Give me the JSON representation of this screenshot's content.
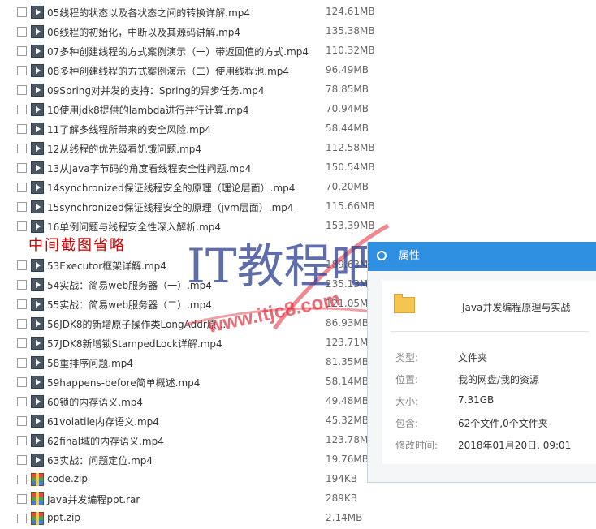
{
  "files": [
    {
      "name": "05线程的状态以及各状态之间的转换详解.mp4",
      "size": "124.61MB",
      "type": "video"
    },
    {
      "name": "06线程的初始化，中断以及其源码讲解.mp4",
      "size": "135.38MB",
      "type": "video"
    },
    {
      "name": "07多种创建线程的方式案例演示（一）带返回值的方式.mp4",
      "size": "110.32MB",
      "type": "video"
    },
    {
      "name": "08多种创建线程的方式案例演示（二）使用线程池.mp4",
      "size": "96.49MB",
      "type": "video"
    },
    {
      "name": "09Spring对并发的支持：Spring的异步任务.mp4",
      "size": "78.85MB",
      "type": "video"
    },
    {
      "name": "10使用jdk8提供的lambda进行并行计算.mp4",
      "size": "70.94MB",
      "type": "video"
    },
    {
      "name": "11了解多线程所带来的安全风险.mp4",
      "size": "58.44MB",
      "type": "video"
    },
    {
      "name": "12从线程的优先级看饥饿问题.mp4",
      "size": "112.58MB",
      "type": "video"
    },
    {
      "name": "13从Java字节码的角度看线程安全性问题.mp4",
      "size": "150.54MB",
      "type": "video"
    },
    {
      "name": "14synchronized保证线程安全的原理（理论层面）.mp4",
      "size": "70.20MB",
      "type": "video"
    },
    {
      "name": "15synchronized保证线程安全的原理（jvm层面）.mp4",
      "size": "115.66MB",
      "type": "video"
    },
    {
      "name": "16单例问题与线程安全性深入解析.mp4",
      "size": "153.39MB",
      "type": "video"
    },
    {
      "name": "53Executor框架详解.mp4",
      "size": "189.63MB",
      "type": "video"
    },
    {
      "name": "54实战：简易web服务器（一）.mp4",
      "size": "235.13MB",
      "type": "video"
    },
    {
      "name": "55实战：简易web服务器（二）.mp4",
      "size": "121.05MB",
      "type": "video"
    },
    {
      "name": "56JDK8的新增原子操作类LongAddr原...",
      "size": "86.93MB",
      "type": "video"
    },
    {
      "name": "57JDK8新增锁StampedLock详解.mp4",
      "size": "123.71MB",
      "type": "video"
    },
    {
      "name": "58重排序问题.mp4",
      "size": "81.35MB",
      "type": "video"
    },
    {
      "name": "59happens-before简单概述.mp4",
      "size": "58.14MB",
      "type": "video"
    },
    {
      "name": "60锁的内存语义.mp4",
      "size": "49.48MB",
      "type": "video"
    },
    {
      "name": "61volatile内存语义.mp4",
      "size": "45.32MB",
      "type": "video"
    },
    {
      "name": "62final域的内存语义.mp4",
      "size": "123.78MB",
      "type": "video"
    },
    {
      "name": "63实战：问题定位.mp4",
      "size": "19.76MB",
      "type": "video"
    },
    {
      "name": "code.zip",
      "size": "194KB",
      "type": "zip"
    },
    {
      "name": "Java并发编程ppt.rar",
      "size": "289KB",
      "type": "zip"
    },
    {
      "name": "ppt.zip",
      "size": "2.14MB",
      "type": "zip"
    }
  ],
  "watermark": {
    "note": "中间截图省略",
    "logo_text": "IT教程吧",
    "url": "www.itjc8.com",
    "color": "#e23b4a"
  },
  "properties": {
    "title": "属性",
    "folder_name": "Java并发编程原理与实战",
    "rows": [
      {
        "label": "类型:",
        "value": "文件夹"
      },
      {
        "label": "位置:",
        "value": "我的网盘/我的资源"
      },
      {
        "label": "大小:",
        "value": "7.31GB"
      },
      {
        "label": "包含:",
        "value": "62个文件,0个文件夹"
      },
      {
        "label": "修改时间:",
        "value": "2018年01月20日, 09:01"
      }
    ]
  },
  "colors": {
    "header_blue": "#2f8fe0",
    "video_icon": "#4a5866",
    "note_red": "#d10000"
  }
}
